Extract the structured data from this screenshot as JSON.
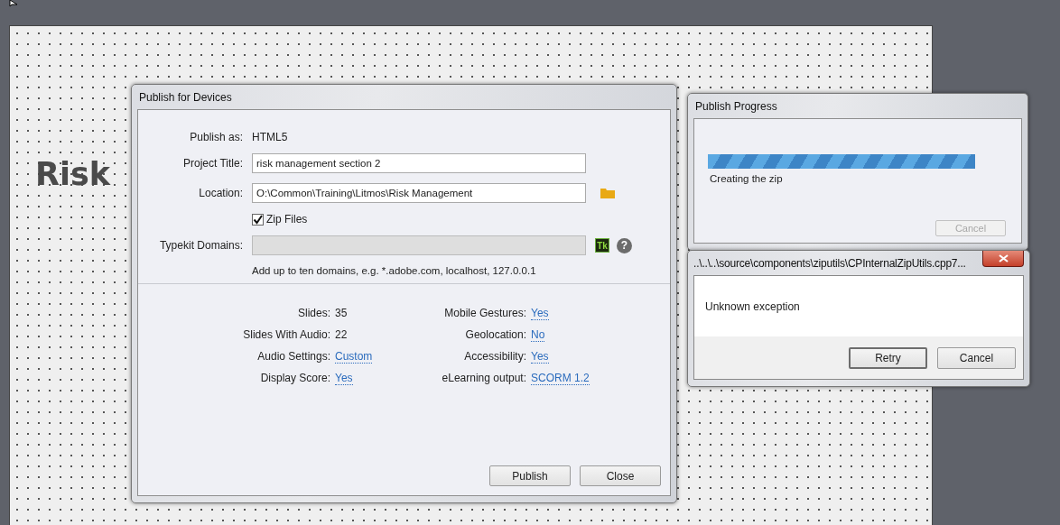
{
  "stage": {
    "heading": "Risk"
  },
  "publish_dialog": {
    "title": "Publish for Devices",
    "rows": [
      {
        "kind": "static",
        "label": "Publish as:",
        "value": "HTML5"
      },
      {
        "kind": "input",
        "label": "Project Title:",
        "value": "risk management section 2"
      },
      {
        "kind": "path",
        "label": "Location:",
        "value": "O:\\Common\\Training\\Litmos\\Risk Management"
      },
      {
        "kind": "checkbox",
        "label": "Zip Files",
        "checked": true
      },
      {
        "kind": "typekit",
        "label": "Typekit Domains:",
        "disabled": true,
        "badge": "Tk",
        "help": "?"
      },
      {
        "kind": "hint",
        "value": "Add up to ten domains, e.g. *.adobe.com, localhost, 127.0.0.1"
      }
    ],
    "stats": [
      {
        "label": "Slides:",
        "value": "35",
        "kind": "text"
      },
      {
        "label": "Mobile Gestures:",
        "value": "Yes",
        "kind": "link"
      },
      {
        "label": "Slides With Audio:",
        "value": "22",
        "kind": "text"
      },
      {
        "label": "Geolocation:",
        "value": "No",
        "kind": "link"
      },
      {
        "label": "Audio Settings:",
        "value": "Custom",
        "kind": "link"
      },
      {
        "label": "Accessibility:",
        "value": "Yes",
        "kind": "link"
      },
      {
        "label": "Display Score:",
        "value": "Yes",
        "kind": "link"
      },
      {
        "label": "eLearning output:",
        "value": "SCORM 1.2",
        "kind": "link"
      }
    ],
    "buttons": [
      "Publish",
      "Close"
    ]
  },
  "progress_dialog": {
    "title": "Publish Progress",
    "level": 1,
    "status": "Creating the zip",
    "cancel": {
      "label": "Cancel",
      "disabled": true
    }
  },
  "error_dialog": {
    "title": "..\\..\\..\\source\\components\\ziputils\\CPInternalZipUtils.cpp7...",
    "message": "Unknown exception",
    "buttons": [
      {
        "label": "Retry",
        "default": true
      },
      {
        "label": "Cancel",
        "default": false
      }
    ]
  }
}
